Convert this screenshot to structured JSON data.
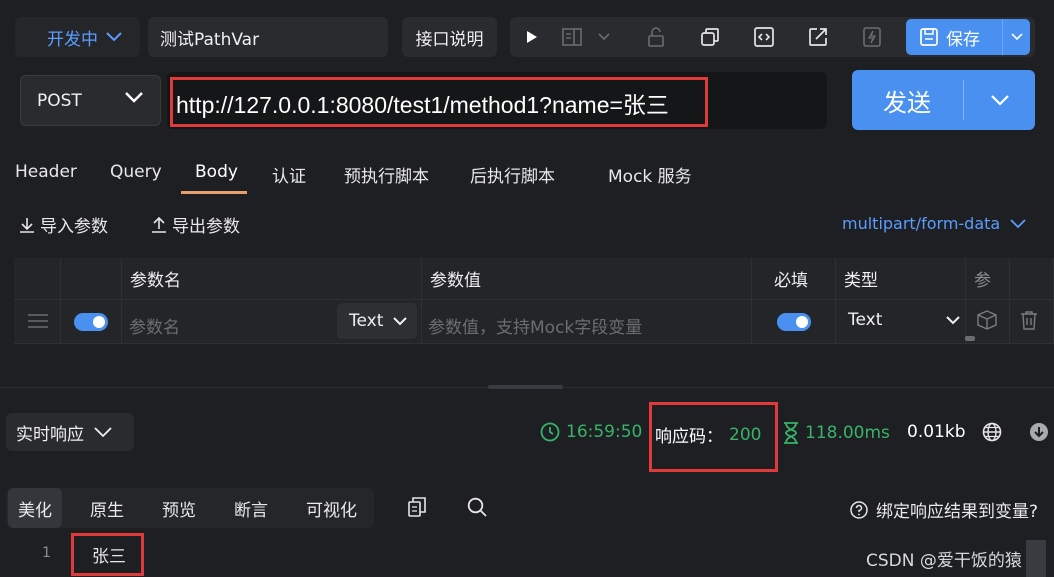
{
  "toolbar": {
    "environment": "开发中",
    "case_name": "测试PathVar",
    "doc_button": "接口说明",
    "save_label": "保存",
    "icons": [
      "play-icon",
      "layout-icon",
      "chevron-down-icon",
      "lock-icon",
      "copy-icon",
      "code-icon",
      "share-icon",
      "flash-icon",
      "save-icon"
    ]
  },
  "request": {
    "method": "POST",
    "url": "http://127.0.0.1:8080/test1/method1?name=张三",
    "send_label": "发送"
  },
  "request_tabs": [
    "Header",
    "Query",
    "Body",
    "认证",
    "预执行脚本",
    "后执行脚本",
    "Mock 服务"
  ],
  "active_request_tab": "Body",
  "body": {
    "import_label": "导入参数",
    "export_label": "导出参数",
    "content_type": "multipart/form-data",
    "table": {
      "headers": [
        "参数名",
        "参数值",
        "必填",
        "类型",
        "参"
      ],
      "row": {
        "name_placeholder": "参数名",
        "name_type": "Text",
        "value_placeholder": "参数值，支持Mock字段变量",
        "required": true,
        "type": "Text"
      }
    }
  },
  "response": {
    "mode": "实时响应",
    "time": "16:59:50",
    "status_label": "响应码：",
    "status_code": "200",
    "duration": "118.00ms",
    "size": "0.01kb",
    "tabs": [
      "美化",
      "原生",
      "预览",
      "断言",
      "可视化"
    ],
    "active_tab": "美化",
    "bind_label": "绑定响应结果到变量?",
    "lines": [
      {
        "no": "1",
        "text": "张三"
      }
    ]
  },
  "watermark": "CSDN @爱干饭的猿",
  "colors": {
    "background": "#1e1f22",
    "accent": "#4a90f0",
    "link": "#5b9cff",
    "success": "#37b36a",
    "tab_underline": "#e8a06a",
    "annotation": "#e03a3a"
  }
}
